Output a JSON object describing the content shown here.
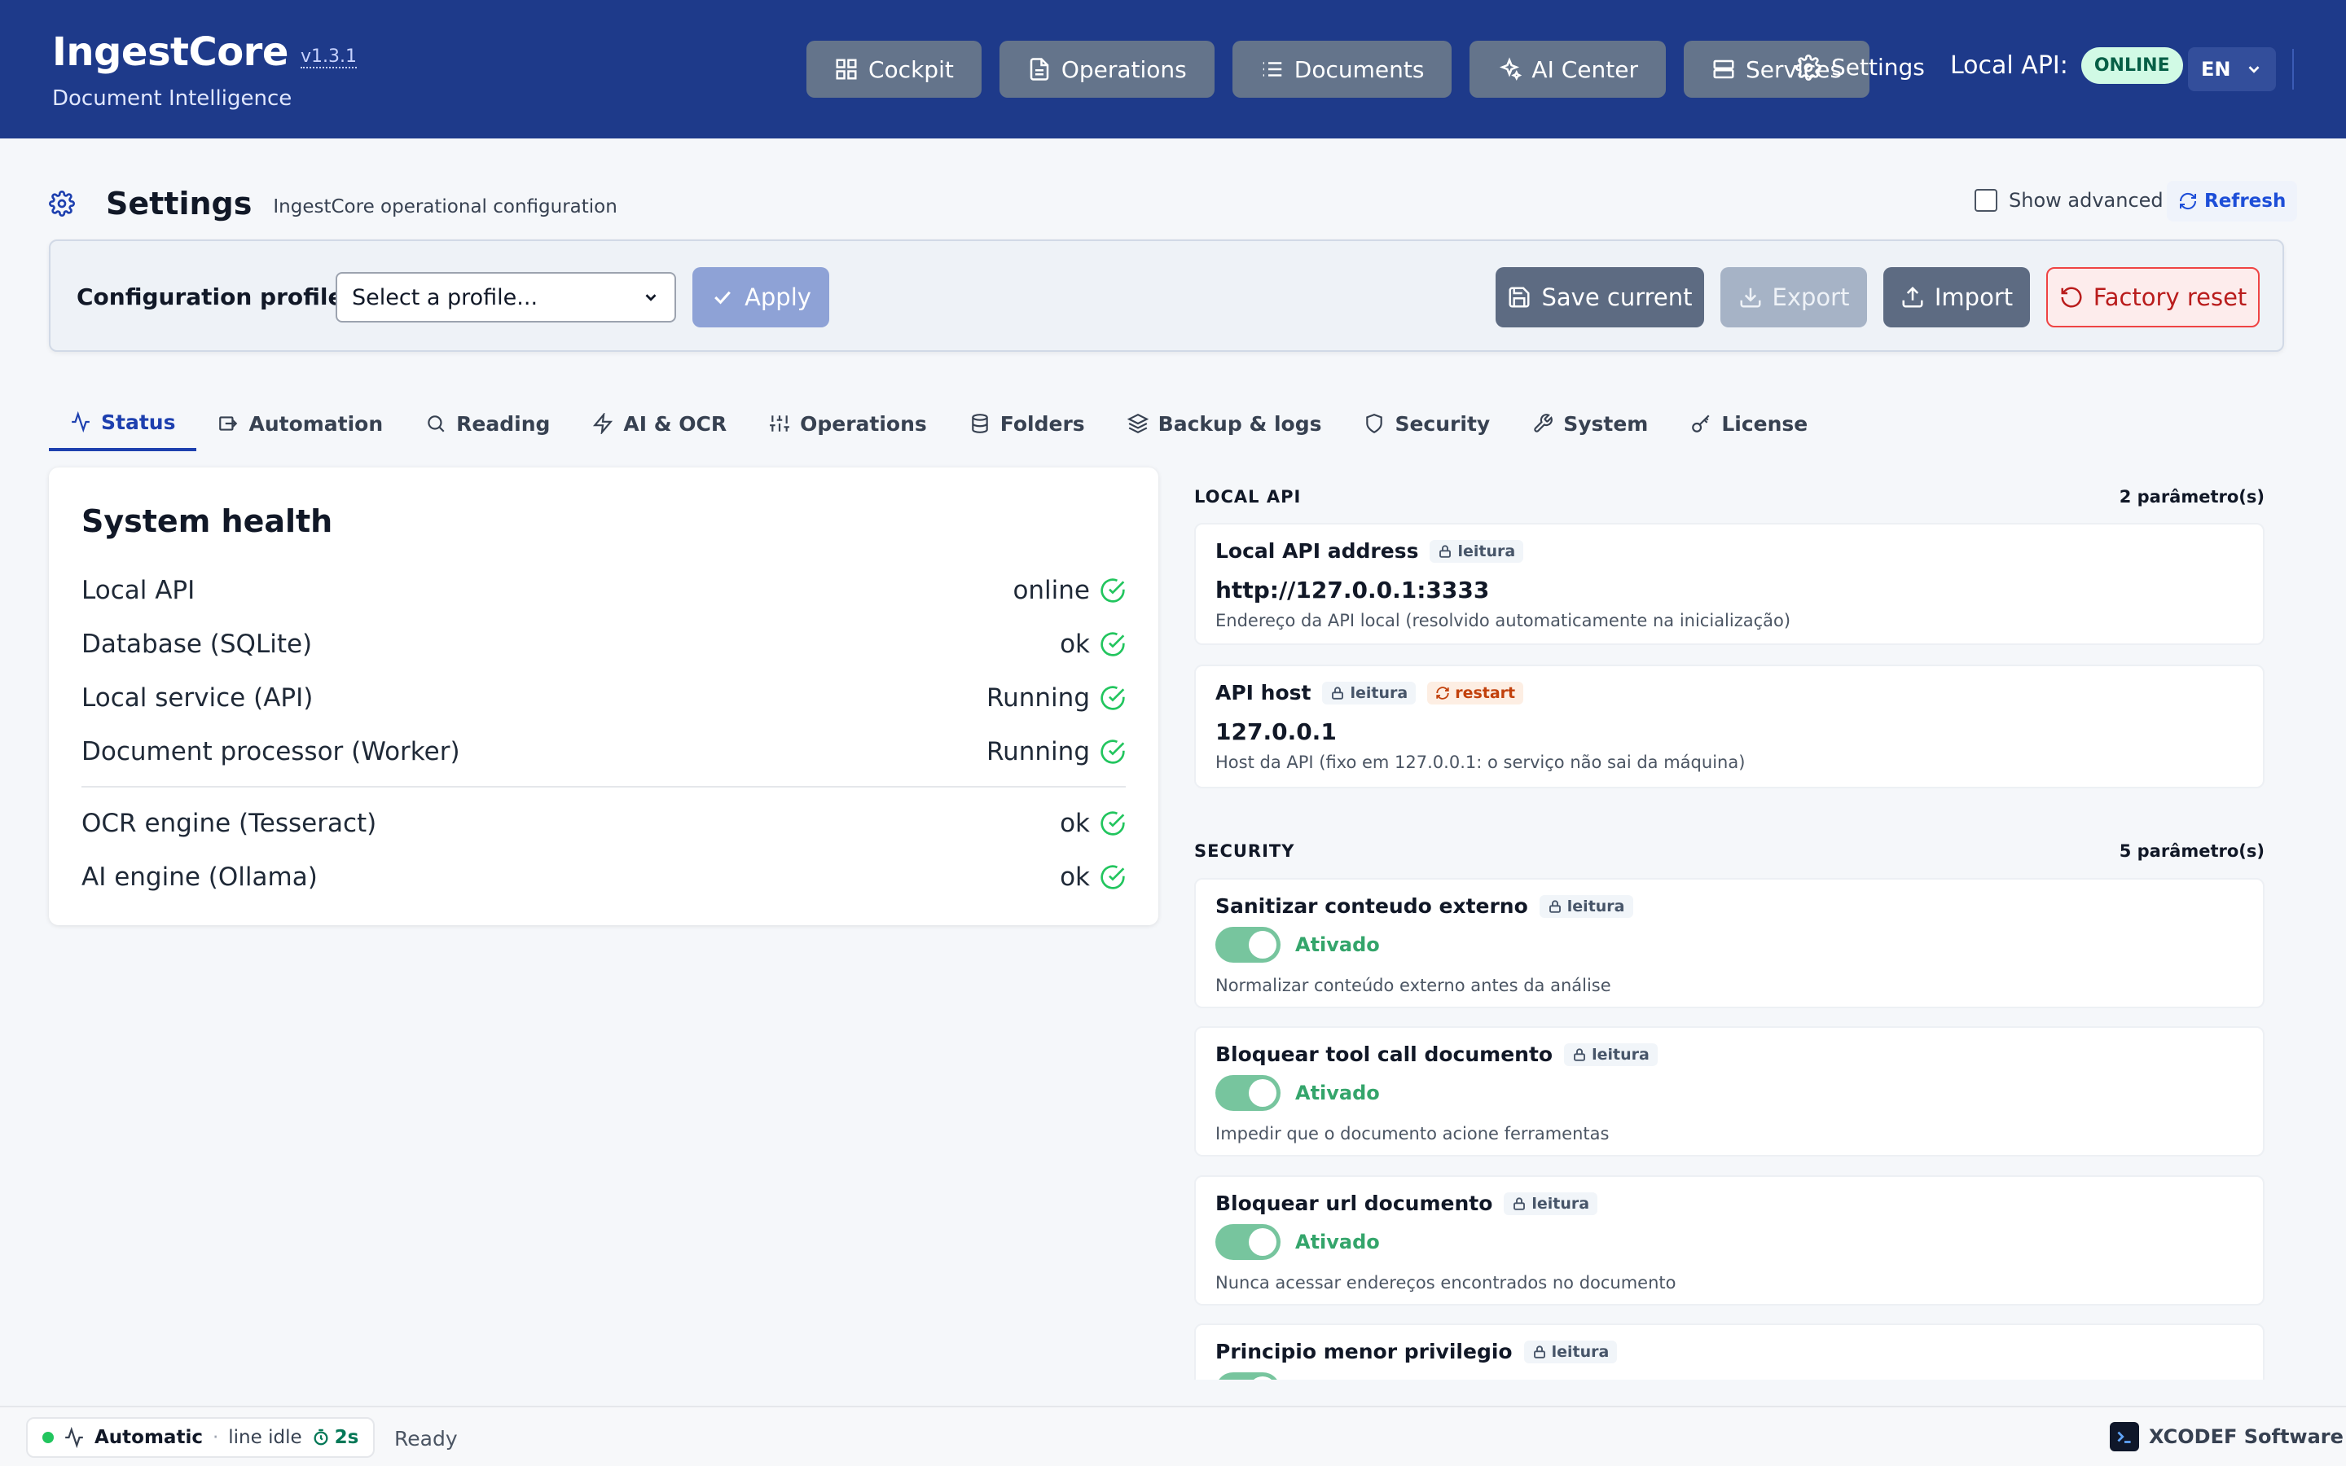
{
  "app": {
    "name": "IngestCore",
    "version": "v1.3.1",
    "subtitle": "Document Intelligence"
  },
  "nav": {
    "items": [
      {
        "label": "Cockpit",
        "icon": "grid-icon"
      },
      {
        "label": "Operations",
        "icon": "file-icon"
      },
      {
        "label": "Documents",
        "icon": "list-icon"
      },
      {
        "label": "AI Center",
        "icon": "sparkles-icon"
      },
      {
        "label": "Services",
        "icon": "server-icon"
      }
    ],
    "settings_label": "Settings",
    "api_label": "Local API:",
    "api_status": "ONLINE",
    "language": "EN"
  },
  "page": {
    "title": "Settings",
    "subtitle": "IngestCore operational configuration",
    "show_advanced_label": "Show advanced",
    "show_advanced_checked": false,
    "refresh_label": "Refresh"
  },
  "profiles": {
    "label": "Configuration profiles:",
    "select_value": "Select a profile...",
    "apply_label": "Apply",
    "save_label": "Save current",
    "export_label": "Export",
    "import_label": "Import",
    "reset_label": "Factory reset"
  },
  "tabs": [
    {
      "label": "Status",
      "icon": "activity-icon",
      "active": true
    },
    {
      "label": "Automation",
      "icon": "automation-icon",
      "active": false
    },
    {
      "label": "Reading",
      "icon": "search-icon",
      "active": false
    },
    {
      "label": "AI & OCR",
      "icon": "bolt-icon",
      "active": false
    },
    {
      "label": "Operations",
      "icon": "sliders-icon",
      "active": false
    },
    {
      "label": "Folders",
      "icon": "database-icon",
      "active": false
    },
    {
      "label": "Backup & logs",
      "icon": "layers-icon",
      "active": false
    },
    {
      "label": "Security",
      "icon": "shield-icon",
      "active": false
    },
    {
      "label": "System",
      "icon": "wrench-icon",
      "active": false
    },
    {
      "label": "License",
      "icon": "key-icon",
      "active": false
    }
  ],
  "health": {
    "title": "System health",
    "rows": [
      {
        "label": "Local API",
        "value": "online"
      },
      {
        "label": "Database (SQLite)",
        "value": "ok"
      },
      {
        "label": "Local service (API)",
        "value": "Running"
      },
      {
        "label": "Document processor (Worker)",
        "value": "Running"
      },
      {
        "label": "OCR engine (Tesseract)",
        "value": "ok"
      },
      {
        "label": "AI engine (Ollama)",
        "value": "ok"
      }
    ]
  },
  "local_api": {
    "title": "LOCAL API",
    "count": "2 parâmetro(s)",
    "params": [
      {
        "title": "Local API address",
        "tag": "leitura",
        "value": "http://127.0.0.1:3333",
        "desc": "Endereço da API local (resolvido automaticamente na inicialização)"
      },
      {
        "title": "API host",
        "tag": "leitura",
        "tag2": "restart",
        "value": "127.0.0.1",
        "desc": "Host da API (fixo em 127.0.0.1: o serviço não sai da máquina)"
      }
    ]
  },
  "security": {
    "title": "SECURITY",
    "count": "5 parâmetro(s)",
    "params": [
      {
        "title": "Sanitizar conteudo externo",
        "tag": "leitura",
        "state": "Ativado",
        "desc": "Normalizar conteúdo externo antes da análise"
      },
      {
        "title": "Bloquear tool call documento",
        "tag": "leitura",
        "state": "Ativado",
        "desc": "Impedir que o documento acione ferramentas"
      },
      {
        "title": "Bloquear url documento",
        "tag": "leitura",
        "state": "Ativado",
        "desc": "Nunca acessar endereços encontrados no documento"
      },
      {
        "title": "Principio menor privilegio",
        "tag": "leitura"
      }
    ]
  },
  "footer": {
    "mode": "Automatic",
    "separator": "·",
    "line_state": "line idle",
    "timer": "2s",
    "ready": "Ready",
    "vendor": "XCODEF Software"
  },
  "colors": {
    "header_bg": "#1e3a8a",
    "nav_button": "#64748b",
    "accent": "#1e40af",
    "success": "#22c55e",
    "danger": "#ef4444"
  }
}
